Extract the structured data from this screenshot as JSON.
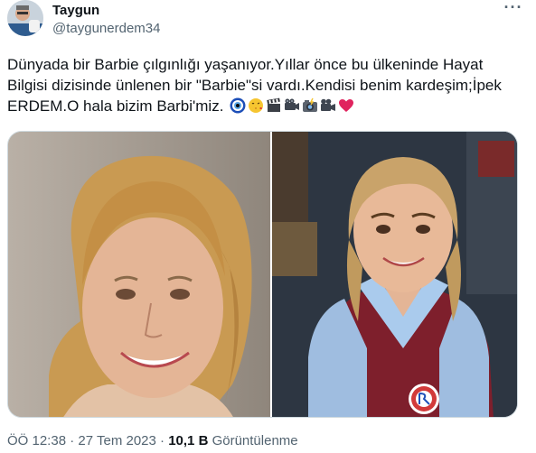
{
  "author": {
    "display_name": "Taygun",
    "handle": "@taygunerdem34"
  },
  "tweet": {
    "text": "Dünyada bir Barbie çılgınlığı yaşanıyor.Yıllar önce bu ülkeninde Hayat Bilgisi dizisinde ünlenen bir \"Barbie\"si vardı.Kendisi benim kardeşim;İpek ERDEM.O hala bizim Barbi'miz.",
    "emojis": [
      "nazar-icon",
      "kiss-face-icon",
      "clapper-icon",
      "camera-icon",
      "camera-flash-icon",
      "movie-camera-icon",
      "heart-icon"
    ]
  },
  "meta": {
    "time": "ÖÖ 12:38",
    "separator": "·",
    "date": "27 Tem 2023",
    "views_count": "10,1 B",
    "views_label": "Görüntülenme"
  },
  "more_label": "···"
}
